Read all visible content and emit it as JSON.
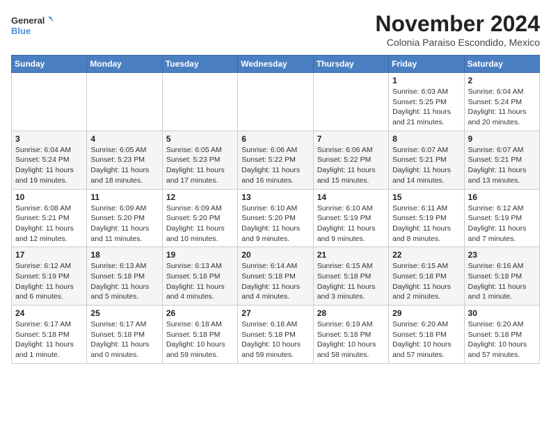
{
  "header": {
    "logo_line1": "General",
    "logo_line2": "Blue",
    "month_title": "November 2024",
    "subtitle": "Colonia Paraiso Escondido, Mexico"
  },
  "days_of_week": [
    "Sunday",
    "Monday",
    "Tuesday",
    "Wednesday",
    "Thursday",
    "Friday",
    "Saturday"
  ],
  "weeks": [
    [
      {
        "day": "",
        "info": ""
      },
      {
        "day": "",
        "info": ""
      },
      {
        "day": "",
        "info": ""
      },
      {
        "day": "",
        "info": ""
      },
      {
        "day": "",
        "info": ""
      },
      {
        "day": "1",
        "info": "Sunrise: 6:03 AM\nSunset: 5:25 PM\nDaylight: 11 hours and 21 minutes."
      },
      {
        "day": "2",
        "info": "Sunrise: 6:04 AM\nSunset: 5:24 PM\nDaylight: 11 hours and 20 minutes."
      }
    ],
    [
      {
        "day": "3",
        "info": "Sunrise: 6:04 AM\nSunset: 5:24 PM\nDaylight: 11 hours and 19 minutes."
      },
      {
        "day": "4",
        "info": "Sunrise: 6:05 AM\nSunset: 5:23 PM\nDaylight: 11 hours and 18 minutes."
      },
      {
        "day": "5",
        "info": "Sunrise: 6:05 AM\nSunset: 5:23 PM\nDaylight: 11 hours and 17 minutes."
      },
      {
        "day": "6",
        "info": "Sunrise: 6:06 AM\nSunset: 5:22 PM\nDaylight: 11 hours and 16 minutes."
      },
      {
        "day": "7",
        "info": "Sunrise: 6:06 AM\nSunset: 5:22 PM\nDaylight: 11 hours and 15 minutes."
      },
      {
        "day": "8",
        "info": "Sunrise: 6:07 AM\nSunset: 5:21 PM\nDaylight: 11 hours and 14 minutes."
      },
      {
        "day": "9",
        "info": "Sunrise: 6:07 AM\nSunset: 5:21 PM\nDaylight: 11 hours and 13 minutes."
      }
    ],
    [
      {
        "day": "10",
        "info": "Sunrise: 6:08 AM\nSunset: 5:21 PM\nDaylight: 11 hours and 12 minutes."
      },
      {
        "day": "11",
        "info": "Sunrise: 6:09 AM\nSunset: 5:20 PM\nDaylight: 11 hours and 11 minutes."
      },
      {
        "day": "12",
        "info": "Sunrise: 6:09 AM\nSunset: 5:20 PM\nDaylight: 11 hours and 10 minutes."
      },
      {
        "day": "13",
        "info": "Sunrise: 6:10 AM\nSunset: 5:20 PM\nDaylight: 11 hours and 9 minutes."
      },
      {
        "day": "14",
        "info": "Sunrise: 6:10 AM\nSunset: 5:19 PM\nDaylight: 11 hours and 9 minutes."
      },
      {
        "day": "15",
        "info": "Sunrise: 6:11 AM\nSunset: 5:19 PM\nDaylight: 11 hours and 8 minutes."
      },
      {
        "day": "16",
        "info": "Sunrise: 6:12 AM\nSunset: 5:19 PM\nDaylight: 11 hours and 7 minutes."
      }
    ],
    [
      {
        "day": "17",
        "info": "Sunrise: 6:12 AM\nSunset: 5:19 PM\nDaylight: 11 hours and 6 minutes."
      },
      {
        "day": "18",
        "info": "Sunrise: 6:13 AM\nSunset: 5:18 PM\nDaylight: 11 hours and 5 minutes."
      },
      {
        "day": "19",
        "info": "Sunrise: 6:13 AM\nSunset: 5:18 PM\nDaylight: 11 hours and 4 minutes."
      },
      {
        "day": "20",
        "info": "Sunrise: 6:14 AM\nSunset: 5:18 PM\nDaylight: 11 hours and 4 minutes."
      },
      {
        "day": "21",
        "info": "Sunrise: 6:15 AM\nSunset: 5:18 PM\nDaylight: 11 hours and 3 minutes."
      },
      {
        "day": "22",
        "info": "Sunrise: 6:15 AM\nSunset: 5:18 PM\nDaylight: 11 hours and 2 minutes."
      },
      {
        "day": "23",
        "info": "Sunrise: 6:16 AM\nSunset: 5:18 PM\nDaylight: 11 hours and 1 minute."
      }
    ],
    [
      {
        "day": "24",
        "info": "Sunrise: 6:17 AM\nSunset: 5:18 PM\nDaylight: 11 hours and 1 minute."
      },
      {
        "day": "25",
        "info": "Sunrise: 6:17 AM\nSunset: 5:18 PM\nDaylight: 11 hours and 0 minutes."
      },
      {
        "day": "26",
        "info": "Sunrise: 6:18 AM\nSunset: 5:18 PM\nDaylight: 10 hours and 59 minutes."
      },
      {
        "day": "27",
        "info": "Sunrise: 6:18 AM\nSunset: 5:18 PM\nDaylight: 10 hours and 59 minutes."
      },
      {
        "day": "28",
        "info": "Sunrise: 6:19 AM\nSunset: 5:18 PM\nDaylight: 10 hours and 58 minutes."
      },
      {
        "day": "29",
        "info": "Sunrise: 6:20 AM\nSunset: 5:18 PM\nDaylight: 10 hours and 57 minutes."
      },
      {
        "day": "30",
        "info": "Sunrise: 6:20 AM\nSunset: 5:18 PM\nDaylight: 10 hours and 57 minutes."
      }
    ]
  ]
}
